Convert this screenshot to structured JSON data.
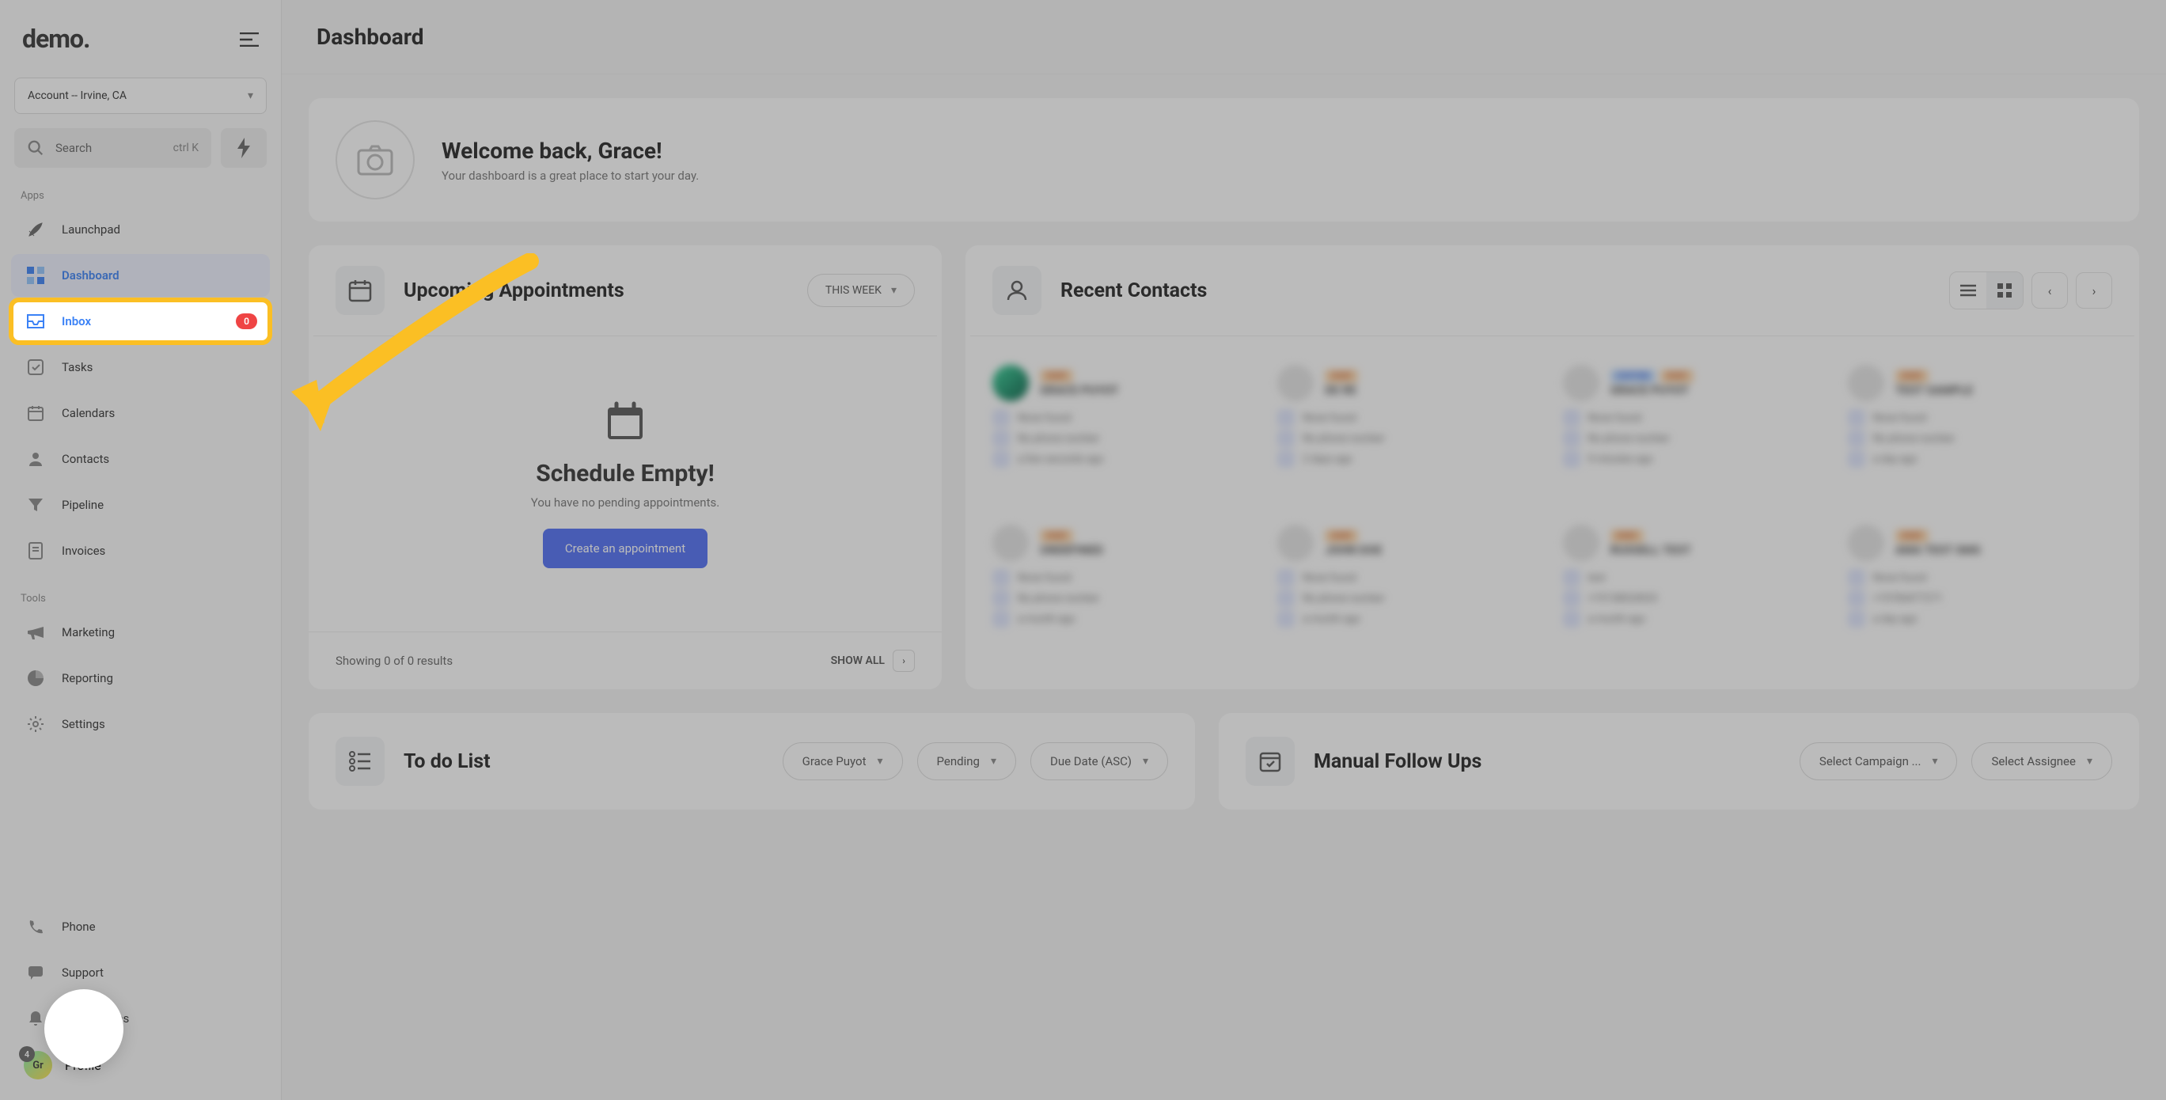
{
  "brand": "demo",
  "account_selector": "Account -- Irvine, CA",
  "search": {
    "placeholder": "Search",
    "kbd": "ctrl K"
  },
  "sections": {
    "apps": "Apps",
    "tools": "Tools"
  },
  "nav": {
    "launchpad": "Launchpad",
    "dashboard": "Dashboard",
    "inbox": "Inbox",
    "inbox_badge": "0",
    "tasks": "Tasks",
    "calendars": "Calendars",
    "contacts": "Contacts",
    "pipeline": "Pipeline",
    "invoices": "Invoices",
    "marketing": "Marketing",
    "reporting": "Reporting",
    "settings": "Settings",
    "phone": "Phone",
    "support": "Support",
    "notifications": "Notifications",
    "profile": "Profile",
    "notif_count": "4",
    "avatar_initials": "Gr"
  },
  "header": {
    "title": "Dashboard"
  },
  "welcome": {
    "title": "Welcome back, Grace!",
    "subtitle": "Your dashboard is a great place to start your day."
  },
  "appointments": {
    "title": "Upcoming Appointments",
    "range": "THIS WEEK",
    "empty_title": "Schedule Empty!",
    "empty_sub": "You have no pending appointments.",
    "create_btn": "Create an appointment",
    "footer_results": "Showing 0 of 0 results",
    "show_all": "SHOW ALL"
  },
  "contacts_widget": {
    "title": "Recent Contacts"
  },
  "contacts": [
    {
      "chips": [
        "CHAT"
      ],
      "name": "GRACE PUYOT",
      "line1": "None found",
      "line2": "No phone number",
      "line3": "a few seconds ago",
      "photo": true
    },
    {
      "chips": [
        "CHAT"
      ],
      "name": "DE RE",
      "line1": "None found",
      "line2": "No phone number",
      "line3": "2 days ago"
    },
    {
      "chips": [
        "CUSTOM",
        "CHAT"
      ],
      "name": "GRACE PUYOT",
      "line1": "None found",
      "line2": "No phone number",
      "line3": "9 minutes ago"
    },
    {
      "chips": [
        "CHAT"
      ],
      "name": "TEST SAMPLE",
      "line1": "None found",
      "line2": "No phone number",
      "line3": "a day ago"
    },
    {
      "chips": [
        "CHAT"
      ],
      "name": "UNDEFINED",
      "line1": "None found",
      "line2": "No phone number",
      "line3": "a month ago"
    },
    {
      "chips": [
        "CHAT"
      ],
      "name": "JOHN DOE",
      "line1": "None found",
      "line2": "No phone number",
      "line3": "a month ago"
    },
    {
      "chips": [
        "CHAT"
      ],
      "name": "RUSSELL TEST",
      "line1": "test",
      "line2": "+19138024033",
      "line3": "a month ago"
    },
    {
      "chips": [
        "CHAT"
      ],
      "name": "AMA TEST SMS",
      "line1": "None found",
      "line2": "+19784477271",
      "line3": "a day ago"
    }
  ],
  "todo": {
    "title": "To do List",
    "filter_user": "Grace Puyot",
    "filter_status": "Pending",
    "filter_sort": "Due Date (ASC)"
  },
  "followups": {
    "title": "Manual Follow Ups",
    "filter_campaign": "Select Campaign ...",
    "filter_assignee": "Select Assignee"
  }
}
